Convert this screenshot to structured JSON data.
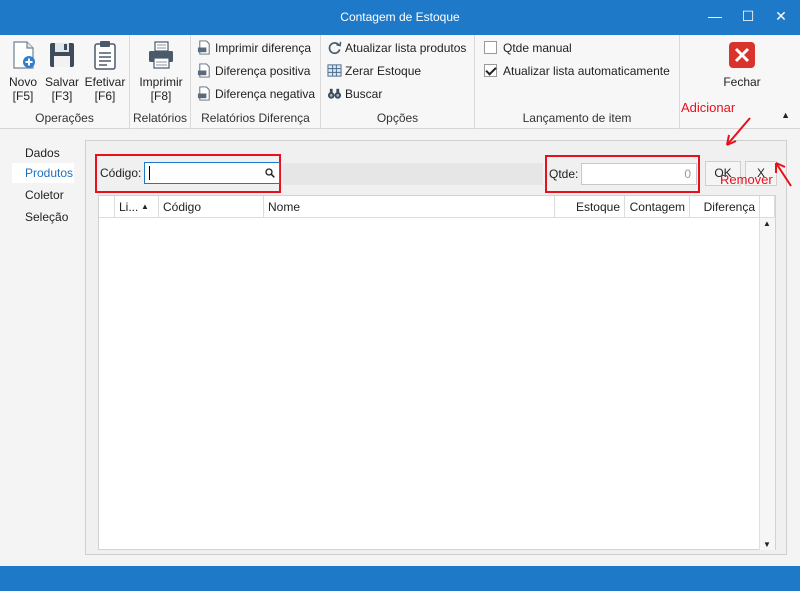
{
  "window": {
    "title": "Contagem de Estoque",
    "min_glyph": "—",
    "max_glyph": "☐",
    "close_glyph": "✕"
  },
  "ribbon": {
    "operacoes": {
      "label": "Operações",
      "novo": {
        "label": "Novo",
        "key": "[F5]",
        "icon": "new-document-icon"
      },
      "salvar": {
        "label": "Salvar",
        "key": "[F3]",
        "icon": "floppy-disk-icon"
      },
      "efetivar": {
        "label": "Efetivar",
        "key": "[F6]",
        "icon": "clipboard-icon"
      }
    },
    "relatorios": {
      "label": "Relatórios",
      "imprimir": {
        "label": "Imprimir",
        "key": "[F8]",
        "icon": "printer-icon"
      }
    },
    "relatorios_diferenca": {
      "label": "Relatórios Diferença",
      "items": [
        "Imprimir diferença",
        "Diferença positiva",
        "Diferença negativa"
      ]
    },
    "opcoes": {
      "label": "Opções",
      "items": [
        "Atualizar lista produtos",
        "Zerar Estoque",
        "Buscar"
      ]
    },
    "lancamento": {
      "label": "Lançamento de item",
      "qtde_manual": {
        "label": "Qtde manual",
        "checked": false
      },
      "atualizar_auto": {
        "label": "Atualizar lista automaticamente",
        "checked": true
      }
    },
    "fechar": {
      "label": "Fechar",
      "icon": "close-red-icon"
    },
    "collapse_glyph": "▲"
  },
  "nav": {
    "items": [
      "Dados",
      "Produtos",
      "Coletor",
      "Seleção"
    ],
    "active": "Produtos"
  },
  "form": {
    "codigo_label": "Código:",
    "codigo_value": "",
    "qtde_label": "Qtde:",
    "qtde_placeholder": "0",
    "ok_label": "OK",
    "remove_label": "X"
  },
  "grid": {
    "columns": [
      "Li...",
      "Código",
      "Nome",
      "Estoque",
      "Contagem",
      "Diferença"
    ],
    "sort_glyph": "▲",
    "rows": []
  },
  "annotations": {
    "adicionar": "Adicionar",
    "remover": "Remover"
  },
  "colors": {
    "accent": "#1e7ac9",
    "annotation_red": "#e8101c"
  }
}
